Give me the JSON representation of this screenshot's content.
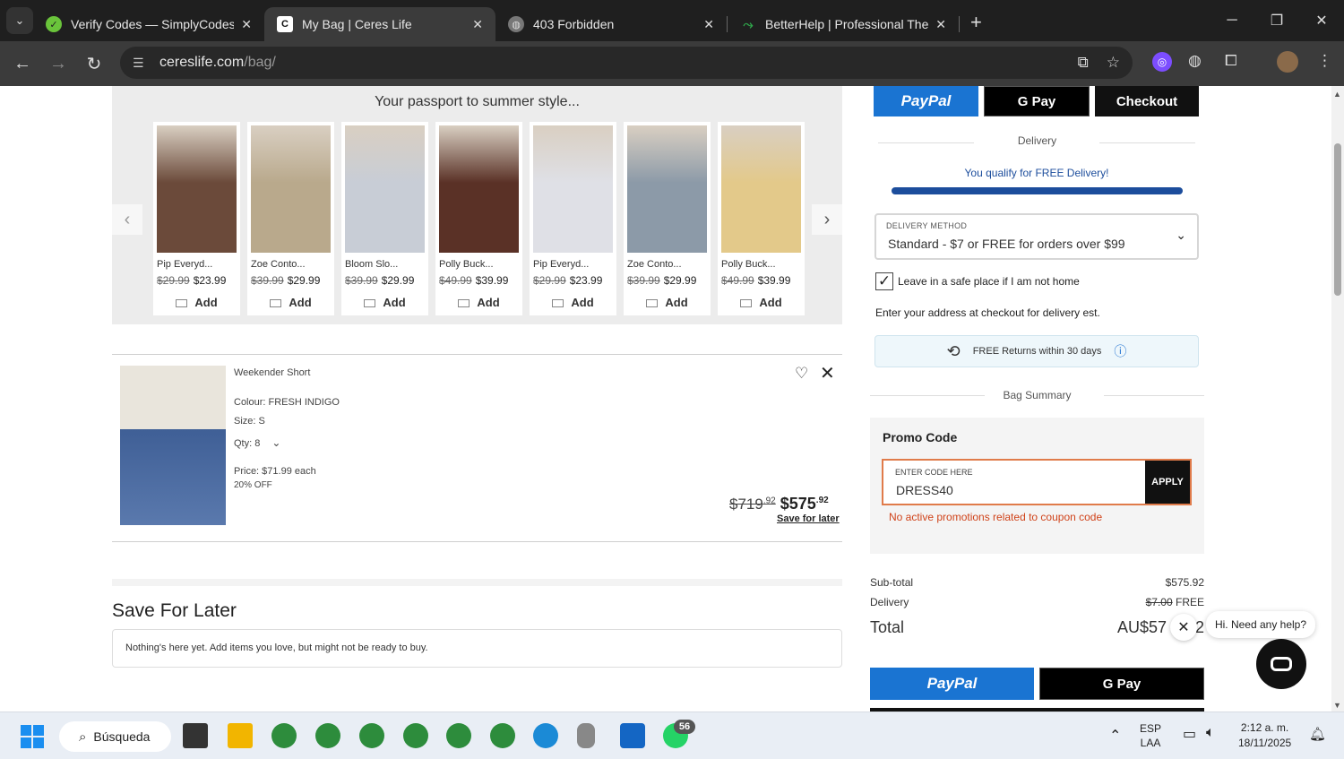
{
  "browser": {
    "tabs": [
      {
        "title": "Verify Codes — SimplyCodes",
        "active": false
      },
      {
        "title": "My Bag | Ceres Life",
        "active": true
      },
      {
        "title": "403 Forbidden",
        "active": false
      },
      {
        "title": "BetterHelp | Professional Therapy",
        "active": false
      }
    ],
    "url_domain": "cereslife.com",
    "url_path": "/bag/"
  },
  "recommendations": {
    "heading": "Your passport to summer style...",
    "add_label": "Add",
    "products": [
      {
        "name": "Pip Everyd...",
        "was": "$29.99",
        "now": "$23.99",
        "color": "#6b4a3a"
      },
      {
        "name": "Zoe Conto...",
        "was": "$39.99",
        "now": "$29.99",
        "color": "#b9a98c"
      },
      {
        "name": "Bloom Slo...",
        "was": "$39.99",
        "now": "$29.99",
        "color": "#c8cdd6"
      },
      {
        "name": "Polly Buck...",
        "was": "$49.99",
        "now": "$39.99",
        "color": "#5a3126"
      },
      {
        "name": "Pip Everyd...",
        "was": "$29.99",
        "now": "$23.99",
        "color": "#dfe0e6"
      },
      {
        "name": "Zoe Conto...",
        "was": "$39.99",
        "now": "$29.99",
        "color": "#8c9aa8"
      },
      {
        "name": "Polly Buck...",
        "was": "$49.99",
        "now": "$39.99",
        "color": "#e3c98a"
      }
    ]
  },
  "bag_item": {
    "name": "Weekender Short",
    "colour": "Colour: FRESH INDIGO",
    "size": "Size: S",
    "qty": "Qty: 8",
    "price_each": "Price: $71.99 each",
    "discount": "20% OFF",
    "was_price": "$719",
    "was_cents": ".92",
    "now_price": "$575",
    "now_cents": ".92",
    "save_for_later": "Save for later"
  },
  "save_for_later": {
    "title": "Save For Later",
    "empty_text": "Nothing's here yet. Add items you love, but might not be ready to buy."
  },
  "checkout_panel": {
    "paypal_label": "PayPal",
    "gpay_label": "G Pay",
    "checkout_label": "Checkout",
    "delivery_heading": "Delivery",
    "free_delivery_msg": "You qualify for FREE Delivery!",
    "free_delivery_progress": 1.0,
    "delivery_method_label": "DELIVERY METHOD",
    "delivery_method_value": "Standard - $7 or FREE for orders over $99",
    "safe_place_label": "Leave in a safe place if I am not home",
    "address_note": "Enter your address at checkout for delivery est.",
    "returns_text": "FREE Returns within 30 days",
    "bag_summary_heading": "Bag Summary",
    "promo": {
      "title": "Promo Code",
      "input_label": "ENTER CODE HERE",
      "input_value": "DRESS40",
      "apply_label": "APPLY",
      "error": "No active promotions related to coupon code"
    },
    "summary": {
      "subtotal_label": "Sub-total",
      "subtotal_value": "$575.92",
      "delivery_label": "Delivery",
      "delivery_was": "$7.00",
      "delivery_value": "FREE",
      "total_label": "Total",
      "total_value": "AU$57",
      "total_tail": "2"
    }
  },
  "chat": {
    "bubble_text": "Hi. Need any help?"
  },
  "taskbar": {
    "search_label": "Búsqueda",
    "lang_top": "ESP",
    "lang_bottom": "LAA",
    "time": "2:12 a. m.",
    "date": "18/11/2025",
    "whatsapp_badge": "56"
  }
}
